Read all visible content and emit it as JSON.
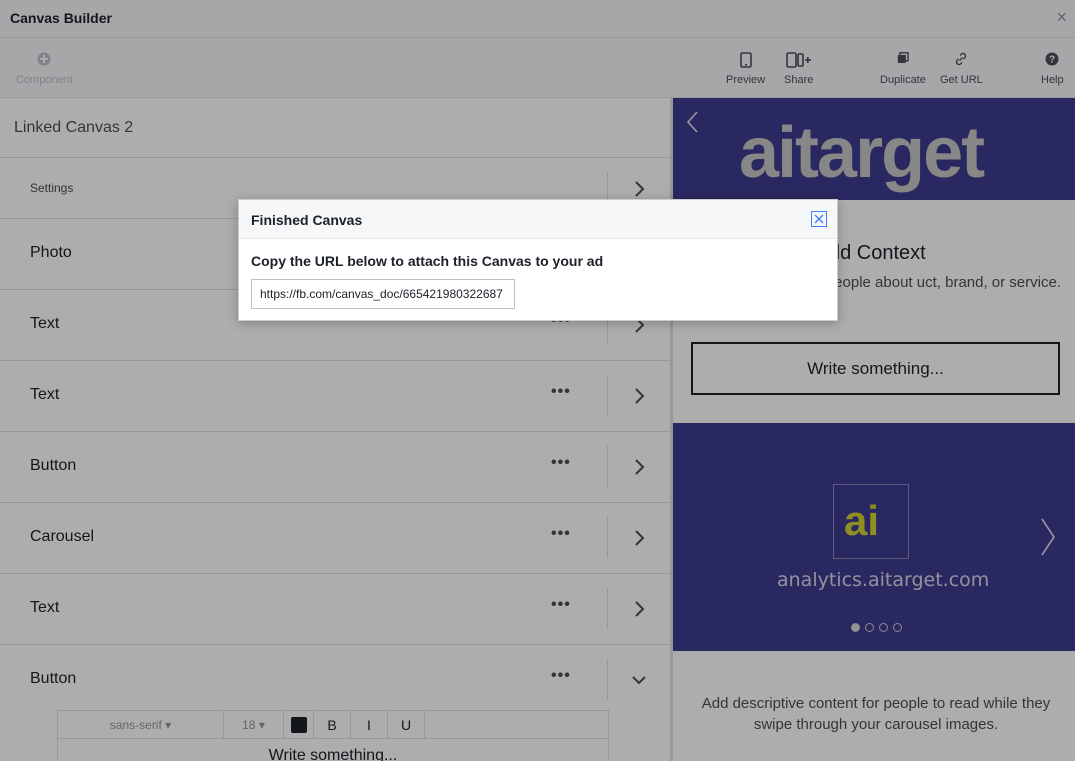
{
  "window": {
    "title": "Canvas Builder",
    "close_glyph": "×"
  },
  "toolbar": {
    "component_label": "Component",
    "preview_label": "Preview",
    "share_label": "Share",
    "duplicate_label": "Duplicate",
    "get_url_label": "Get URL",
    "help_label": "Help"
  },
  "editor": {
    "canvas_name": "Linked Canvas 2",
    "settings_label": "Settings",
    "components": [
      {
        "label": "Photo"
      },
      {
        "label": "Text"
      },
      {
        "label": "Text"
      },
      {
        "label": "Button"
      },
      {
        "label": "Carousel"
      },
      {
        "label": "Text"
      },
      {
        "label": "Button"
      }
    ],
    "more_glyph": "•••",
    "text_editor": {
      "font": "sans-serif",
      "size": "18",
      "bold": "B",
      "italic": "I",
      "underline": "U",
      "content": "Write something..."
    }
  },
  "preview": {
    "logo_text": "aitarget",
    "context_title": "dd Context",
    "context_body": "se this space to tell people about uct, brand, or service.",
    "button_text": "Write something...",
    "carousel": {
      "logo_text": "ai",
      "domain": "analytics.aitarget.com",
      "dots": 4,
      "active_dot": 0
    },
    "description": "Add descriptive content for people to read while they swipe through your carousel images."
  },
  "modal": {
    "title": "Finished Canvas",
    "instruction": "Copy the URL below to attach this Canvas to your ad",
    "url": "https://fb.com/canvas_doc/665421980322687"
  },
  "colors": {
    "brand_purple": "#3f3c8e",
    "accent_yellow": "#d4d431",
    "modal_close_border": "#4080ff"
  }
}
